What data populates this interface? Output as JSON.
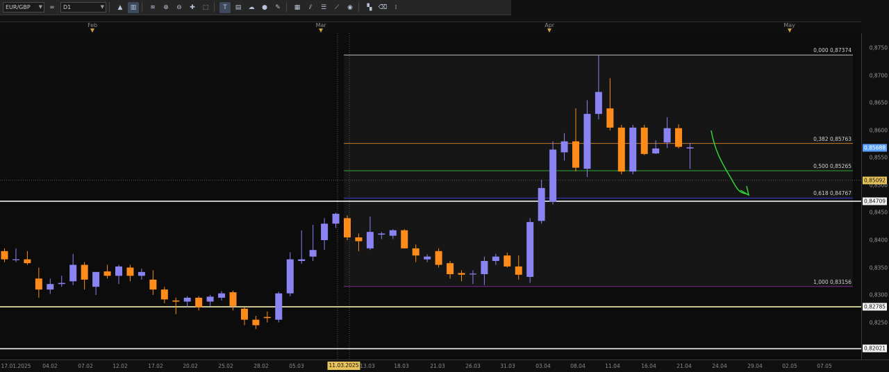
{
  "toolbar": {
    "symbol": "EUR/GBP",
    "period_icon": "∞",
    "timeframe": "D1",
    "buttons": [
      {
        "name": "chart-type-icon",
        "glyph": "▲"
      },
      {
        "name": "candles-icon",
        "glyph": "▥",
        "active": true
      },
      {
        "name": "indicator-icon",
        "glyph": "≋"
      },
      {
        "name": "zoom-in-icon",
        "glyph": "⊕"
      },
      {
        "name": "zoom-out-icon",
        "glyph": "⊖"
      },
      {
        "name": "crosshair-icon",
        "glyph": "✚"
      },
      {
        "name": "cursor-icon",
        "glyph": "⬚"
      },
      {
        "name": "text-tool-icon",
        "glyph": "T",
        "active": true
      },
      {
        "name": "note-icon",
        "glyph": "▤"
      },
      {
        "name": "cloud-icon",
        "glyph": "☁"
      },
      {
        "name": "globe-icon",
        "glyph": "●"
      },
      {
        "name": "pencil-icon",
        "glyph": "✎"
      },
      {
        "name": "table-icon",
        "glyph": "▦"
      },
      {
        "name": "channel-icon",
        "glyph": "⫽"
      },
      {
        "name": "levels-icon",
        "glyph": "☰"
      },
      {
        "name": "trendline-icon",
        "glyph": "⟋"
      },
      {
        "name": "sphere-icon",
        "glyph": "◉"
      },
      {
        "name": "grid-icon",
        "glyph": "▚"
      },
      {
        "name": "eraser-icon",
        "glyph": "⌫"
      },
      {
        "name": "shortcut-icon",
        "glyph": "⁞"
      }
    ]
  },
  "months": [
    {
      "label": "Feb",
      "index": 7.7
    },
    {
      "label": "Mar",
      "index": 27.7
    },
    {
      "label": "Apr",
      "index": 47.7
    },
    {
      "label": "May",
      "index": 68.7
    }
  ],
  "price_ticks": [
    "0,8750",
    "0,8700",
    "0,8650",
    "0,8600",
    "0,8550",
    "0,8500",
    "0,8450",
    "0,8400",
    "0,8350",
    "0,8300",
    "0,8250"
  ],
  "price_badges": [
    {
      "text": "0,85688",
      "price": 0.85688,
      "bg": "#5aa0ff",
      "fg": "#ffffff"
    },
    {
      "text": "0,85092",
      "price": 0.85092,
      "bg": "#e8c35a",
      "fg": "#111111"
    },
    {
      "text": "0,84709",
      "price": 0.84709,
      "bg": "#f4f4f4",
      "fg": "#111111"
    },
    {
      "text": "0,82785",
      "price": 0.82785,
      "bg": "#f4f4f4",
      "fg": "#111111"
    },
    {
      "text": "0,82021",
      "price": 0.82021,
      "bg": "#f4f4f4",
      "fg": "#111111"
    }
  ],
  "date_ticks": [
    "17.01.2025",
    "04.02",
    "07.02",
    "12.02",
    "17.02",
    "20.02",
    "25.02",
    "28.02",
    "05.03",
    "13.03",
    "18.03",
    "21.03",
    "26.03",
    "31.03",
    "03.04",
    "08.04",
    "11.04",
    "16.04",
    "21.04",
    "24.04",
    "29.04",
    "02.05",
    "07.05"
  ],
  "date_highlight": "11.03.2025",
  "fibonacci": [
    {
      "label": "0,000 0,87374",
      "price": 0.87374,
      "color": "#bfbfbf"
    },
    {
      "label": "0,382 0,85763",
      "price": 0.85763,
      "color": "#c87a2a"
    },
    {
      "label": "0,500 0,85265",
      "price": 0.85265,
      "color": "#2ea82e"
    },
    {
      "label": "0,618 0,84767",
      "price": 0.84767,
      "color": "#3b3bd6"
    },
    {
      "label": "1,000 0,83156",
      "price": 0.83156,
      "color": "#7a2a8a"
    }
  ],
  "horizontal_levels": [
    {
      "price": 0.84709,
      "color": "#f0f0f0"
    },
    {
      "price": 0.82785,
      "color": "#f6efb0"
    },
    {
      "price": 0.82021,
      "color": "#f0f0f0"
    }
  ],
  "colors": {
    "bull": "#8a84f2",
    "bear": "#ff8c1a",
    "arrow": "#34d334",
    "background": "#0c0c0c"
  },
  "chart_data": {
    "type": "candlestick",
    "symbol": "EUR/GBP",
    "timeframe": "D1",
    "ylim": [
      0.8185,
      0.8768
    ],
    "candles": [
      {
        "o": 0.838,
        "h": 0.8385,
        "l": 0.836,
        "c": 0.8365
      },
      {
        "o": 0.8365,
        "h": 0.8385,
        "l": 0.836,
        "c": 0.8365
      },
      {
        "o": 0.8365,
        "h": 0.838,
        "l": 0.8355,
        "c": 0.8358
      },
      {
        "o": 0.833,
        "h": 0.835,
        "l": 0.8295,
        "c": 0.831
      },
      {
        "o": 0.831,
        "h": 0.833,
        "l": 0.8302,
        "c": 0.832
      },
      {
        "o": 0.832,
        "h": 0.8335,
        "l": 0.8315,
        "c": 0.8322
      },
      {
        "o": 0.8325,
        "h": 0.8375,
        "l": 0.8318,
        "c": 0.8355
      },
      {
        "o": 0.8355,
        "h": 0.836,
        "l": 0.831,
        "c": 0.8328
      },
      {
        "o": 0.8315,
        "h": 0.834,
        "l": 0.83,
        "c": 0.8342
      },
      {
        "o": 0.8343,
        "h": 0.8355,
        "l": 0.833,
        "c": 0.8335
      },
      {
        "o": 0.8335,
        "h": 0.8355,
        "l": 0.832,
        "c": 0.8352
      },
      {
        "o": 0.835,
        "h": 0.8355,
        "l": 0.8325,
        "c": 0.8335
      },
      {
        "o": 0.8335,
        "h": 0.8348,
        "l": 0.8328,
        "c": 0.8342
      },
      {
        "o": 0.8328,
        "h": 0.8345,
        "l": 0.83,
        "c": 0.831
      },
      {
        "o": 0.831,
        "h": 0.8315,
        "l": 0.8285,
        "c": 0.8292
      },
      {
        "o": 0.829,
        "h": 0.8295,
        "l": 0.8265,
        "c": 0.8288
      },
      {
        "o": 0.8288,
        "h": 0.8298,
        "l": 0.8278,
        "c": 0.8295
      },
      {
        "o": 0.8295,
        "h": 0.8298,
        "l": 0.8272,
        "c": 0.8278
      },
      {
        "o": 0.8288,
        "h": 0.83,
        "l": 0.828,
        "c": 0.8297
      },
      {
        "o": 0.8295,
        "h": 0.8307,
        "l": 0.829,
        "c": 0.8303
      },
      {
        "o": 0.8305,
        "h": 0.8308,
        "l": 0.8272,
        "c": 0.828
      },
      {
        "o": 0.8275,
        "h": 0.8278,
        "l": 0.8245,
        "c": 0.8255
      },
      {
        "o": 0.8255,
        "h": 0.8262,
        "l": 0.8238,
        "c": 0.8245
      },
      {
        "o": 0.826,
        "h": 0.827,
        "l": 0.825,
        "c": 0.8258
      },
      {
        "o": 0.8255,
        "h": 0.8306,
        "l": 0.825,
        "c": 0.8303
      },
      {
        "o": 0.8303,
        "h": 0.8378,
        "l": 0.8298,
        "c": 0.8365
      },
      {
        "o": 0.8362,
        "h": 0.8418,
        "l": 0.8357,
        "c": 0.8365
      },
      {
        "o": 0.837,
        "h": 0.8428,
        "l": 0.8362,
        "c": 0.8382
      },
      {
        "o": 0.84,
        "h": 0.844,
        "l": 0.8382,
        "c": 0.843
      },
      {
        "o": 0.843,
        "h": 0.845,
        "l": 0.8422,
        "c": 0.8448
      },
      {
        "o": 0.844,
        "h": 0.8445,
        "l": 0.84,
        "c": 0.8405
      },
      {
        "o": 0.8405,
        "h": 0.8412,
        "l": 0.838,
        "c": 0.8398
      },
      {
        "o": 0.8385,
        "h": 0.8443,
        "l": 0.8382,
        "c": 0.8415
      },
      {
        "o": 0.841,
        "h": 0.8415,
        "l": 0.8402,
        "c": 0.8412
      },
      {
        "o": 0.8408,
        "h": 0.842,
        "l": 0.8402,
        "c": 0.8418
      },
      {
        "o": 0.8418,
        "h": 0.842,
        "l": 0.8385,
        "c": 0.8385
      },
      {
        "o": 0.8385,
        "h": 0.8392,
        "l": 0.836,
        "c": 0.8372
      },
      {
        "o": 0.8365,
        "h": 0.8374,
        "l": 0.836,
        "c": 0.837
      },
      {
        "o": 0.838,
        "h": 0.8385,
        "l": 0.835,
        "c": 0.8355
      },
      {
        "o": 0.8358,
        "h": 0.8362,
        "l": 0.833,
        "c": 0.8338
      },
      {
        "o": 0.834,
        "h": 0.8345,
        "l": 0.8325,
        "c": 0.8337
      },
      {
        "o": 0.8338,
        "h": 0.8345,
        "l": 0.832,
        "c": 0.8339
      },
      {
        "o": 0.8338,
        "h": 0.837,
        "l": 0.8318,
        "c": 0.8362
      },
      {
        "o": 0.8362,
        "h": 0.8375,
        "l": 0.8355,
        "c": 0.837
      },
      {
        "o": 0.8372,
        "h": 0.8377,
        "l": 0.835,
        "c": 0.8352
      },
      {
        "o": 0.8352,
        "h": 0.8372,
        "l": 0.8328,
        "c": 0.8337
      },
      {
        "o": 0.8333,
        "h": 0.844,
        "l": 0.8322,
        "c": 0.8433
      },
      {
        "o": 0.8435,
        "h": 0.851,
        "l": 0.843,
        "c": 0.8495
      },
      {
        "o": 0.847,
        "h": 0.858,
        "l": 0.8465,
        "c": 0.8565
      },
      {
        "o": 0.856,
        "h": 0.8595,
        "l": 0.8545,
        "c": 0.858
      },
      {
        "o": 0.858,
        "h": 0.864,
        "l": 0.8525,
        "c": 0.8532
      },
      {
        "o": 0.853,
        "h": 0.8655,
        "l": 0.8515,
        "c": 0.863
      },
      {
        "o": 0.863,
        "h": 0.8738,
        "l": 0.862,
        "c": 0.867
      },
      {
        "o": 0.864,
        "h": 0.8695,
        "l": 0.86,
        "c": 0.8605
      },
      {
        "o": 0.8605,
        "h": 0.861,
        "l": 0.852,
        "c": 0.8525
      },
      {
        "o": 0.8525,
        "h": 0.861,
        "l": 0.852,
        "c": 0.8605
      },
      {
        "o": 0.8605,
        "h": 0.861,
        "l": 0.8555,
        "c": 0.8557
      },
      {
        "o": 0.8558,
        "h": 0.8582,
        "l": 0.8557,
        "c": 0.8567
      },
      {
        "o": 0.8578,
        "h": 0.8624,
        "l": 0.8568,
        "c": 0.8604
      },
      {
        "o": 0.8604,
        "h": 0.8611,
        "l": 0.8567,
        "c": 0.857
      },
      {
        "o": 0.8567,
        "h": 0.8577,
        "l": 0.853,
        "c": 0.8569
      }
    ]
  }
}
